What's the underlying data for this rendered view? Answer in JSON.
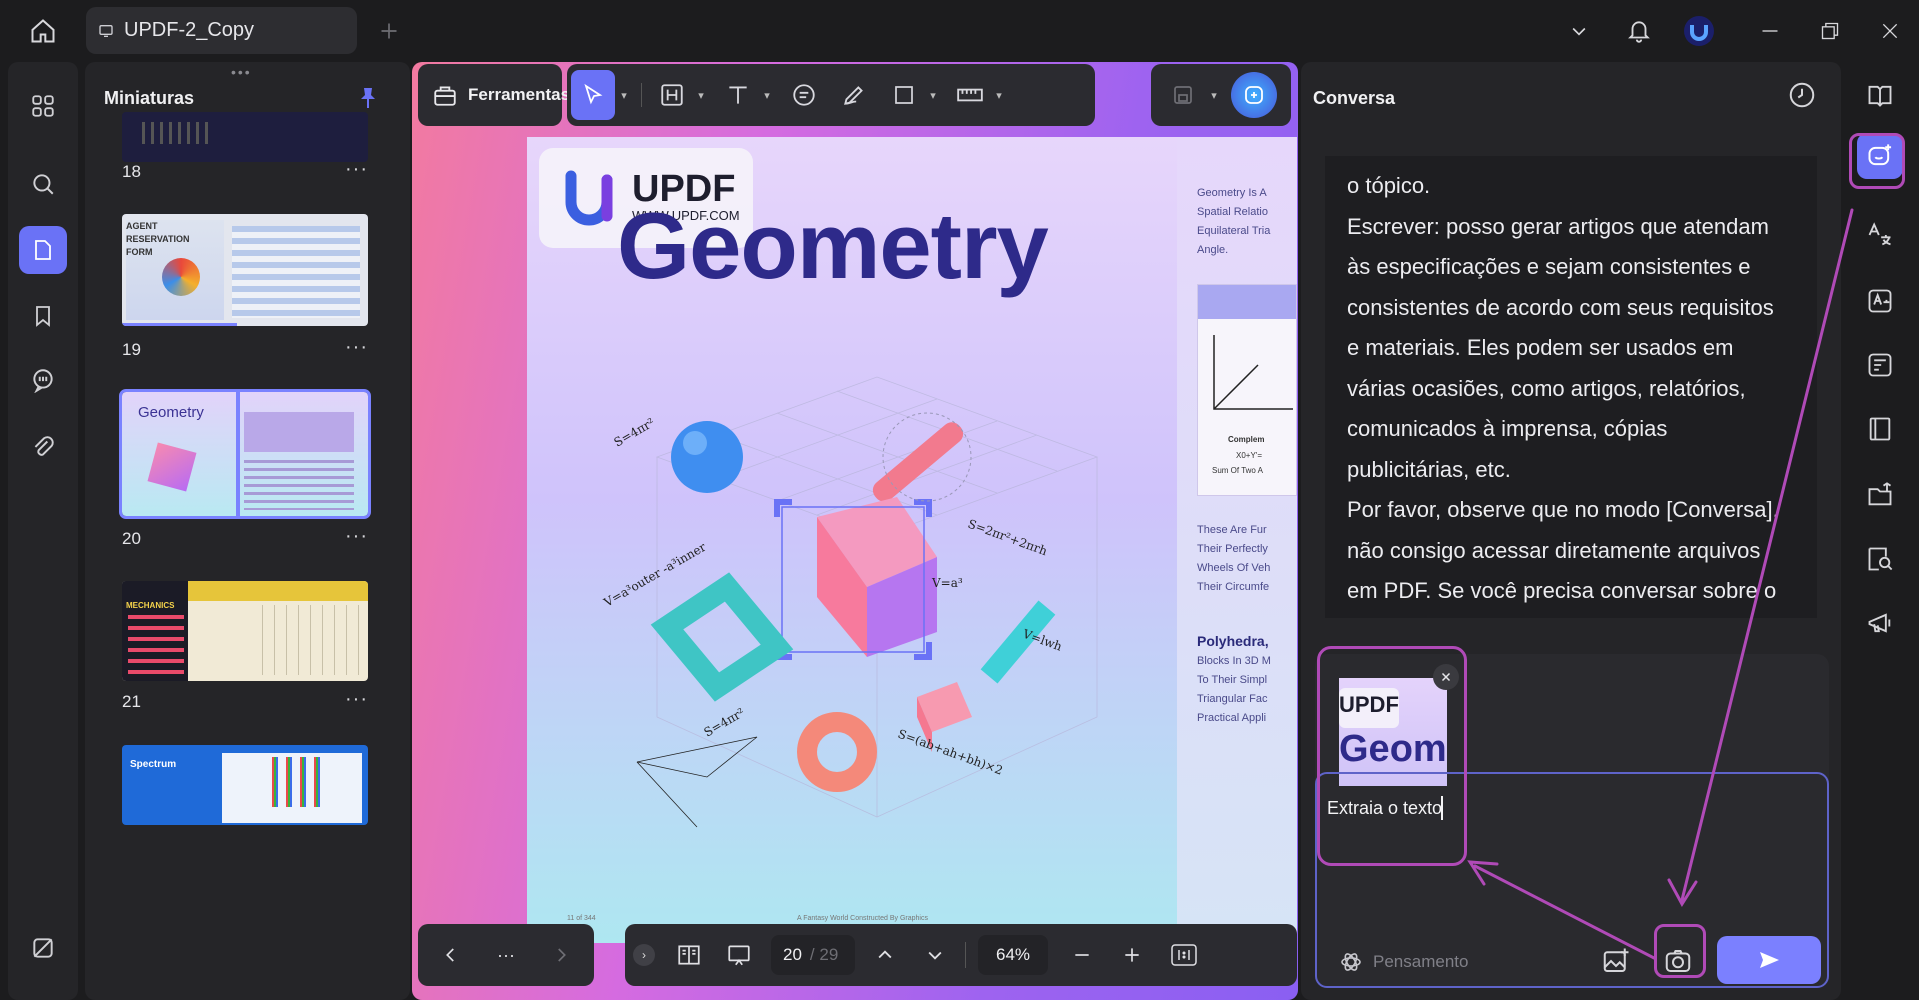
{
  "app": {
    "tab_title": "UPDF-2_Copy"
  },
  "thumbnails": {
    "title": "Miniaturas",
    "pages": [
      {
        "num": "18"
      },
      {
        "num": "19",
        "label": "AGENT RESERVATION FORM"
      },
      {
        "num": "20",
        "label": "Geometry"
      },
      {
        "num": "21",
        "label": "MECHANICS"
      },
      {
        "num": "",
        "label": "Spectrum"
      }
    ],
    "more": "···"
  },
  "toolbar": {
    "tools_label": "Ferramentas"
  },
  "document": {
    "logo_name": "UPDF",
    "logo_url": "WWW.UPDF.COM",
    "title": "Geometry",
    "side_lines": [
      "Geometry Is A",
      "Spatial Relatio",
      "Equilateral Tria",
      "Angle."
    ],
    "side_lines2": [
      "These Are Fur",
      "Their Perfectly",
      "Wheels Of Veh",
      "Their Circumfe"
    ],
    "side_heading": "Polyhedra,",
    "side_lines3": [
      "Blocks In 3D M",
      "To Their Simpl",
      "Triangular Fac",
      "Practical Appli"
    ],
    "chart_caption": [
      "Complem",
      "X0+Y'=",
      "Sum Of Two A"
    ],
    "formulas": [
      "S=4πr²",
      "S=2πr²+2πrh",
      "V=a³",
      "V=a³outer -a³inner",
      "V=lwh",
      "S=4πr²",
      "S=(ab+ah+bh)×2"
    ],
    "footer_left": "11 of 344",
    "footer_center": "A Fantasy World Constructed By Graphics"
  },
  "bottombar": {
    "page_current": "20",
    "page_total": "/ 29",
    "zoom": "64%",
    "more": "···"
  },
  "conversation": {
    "title": "Conversa",
    "message_lines": [
      "o tópico.",
      "Escrever: posso gerar artigos que atendam",
      "às especificações e sejam consistentes e",
      "consistentes de acordo com seus requisitos",
      "e materiais. Eles podem ser usados em",
      "várias ocasiões, como artigos, relatórios,",
      "comunicados à imprensa, cópias",
      "publicitárias, etc.",
      "Por favor, observe que no modo [Conversa],",
      "não consigo acessar diretamente arquivos",
      "em PDF. Se você precisa conversar sobre o"
    ],
    "attachment_preview_text": [
      "UPDF",
      "Geome"
    ],
    "input_value": "Extraia o texto",
    "thinking_label": "Pensamento"
  },
  "colors": {
    "accent": "#6a72f6",
    "annotation": "#b04ab7",
    "send": "#7b80ff"
  }
}
